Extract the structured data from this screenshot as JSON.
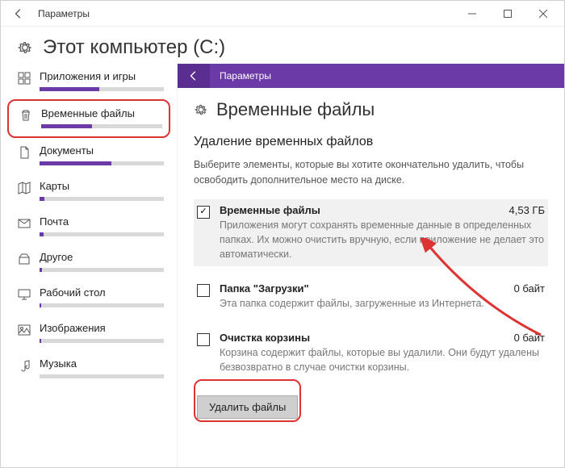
{
  "titlebar": {
    "title": "Параметры"
  },
  "header": {
    "title": "Этот компьютер (C:)"
  },
  "sidebar": {
    "items": [
      {
        "label": "Приложения и игры",
        "fill": 48,
        "icon": "apps"
      },
      {
        "label": "Временные файлы",
        "fill": 42,
        "icon": "trash",
        "highlighted": true
      },
      {
        "label": "Документы",
        "fill": 58,
        "icon": "document"
      },
      {
        "label": "Карты",
        "fill": 4,
        "icon": "map"
      },
      {
        "label": "Почта",
        "fill": 3,
        "icon": "mail"
      },
      {
        "label": "Другое",
        "fill": 2,
        "icon": "other"
      },
      {
        "label": "Рабочий стол",
        "fill": 1,
        "icon": "desktop"
      },
      {
        "label": "Изображения",
        "fill": 1,
        "icon": "images"
      },
      {
        "label": "Музыка",
        "fill": 0,
        "icon": "music"
      }
    ]
  },
  "content": {
    "sub_title": "Параметры",
    "heading": "Временные файлы",
    "section_title": "Удаление временных файлов",
    "hint": "Выберите элементы, которые вы хотите окончательно удалить, чтобы освободить дополнительное место на диске.",
    "options": [
      {
        "name": "Временные файлы",
        "size": "4,53 ГБ",
        "checked": true,
        "shaded": true,
        "desc": "Приложения могут сохранять временные данные в определенных папках. Их можно очистить вручную, если приложение не делает это автоматически."
      },
      {
        "name": "Папка \"Загрузки\"",
        "size": "0 байт",
        "checked": false,
        "shaded": false,
        "desc": "Эта папка содержит файлы, загруженные из Интернета."
      },
      {
        "name": "Очистка корзины",
        "size": "0 байт",
        "checked": false,
        "shaded": false,
        "desc": "Корзина содержит файлы, которые вы удалили. Они будут удалены безвозвратно в случае очистки корзины."
      }
    ],
    "action_label": "Удалить файлы"
  }
}
